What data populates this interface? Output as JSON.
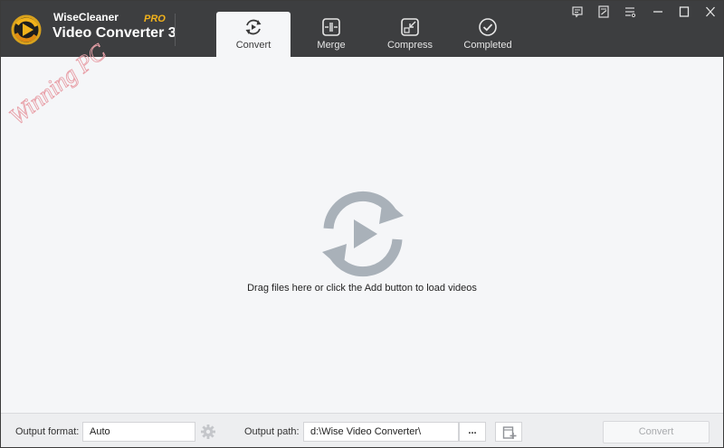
{
  "app": {
    "brand_small": "WiseCleaner",
    "brand_pro": "PRO",
    "brand_big": "Video Converter 3",
    "watermark": "Winning PC"
  },
  "tabs": [
    {
      "label": "Convert",
      "icon": "convert-icon",
      "active": true
    },
    {
      "label": "Merge",
      "icon": "merge-icon",
      "active": false
    },
    {
      "label": "Compress",
      "icon": "compress-icon",
      "active": false
    },
    {
      "label": "Completed",
      "icon": "completed-icon",
      "active": false
    }
  ],
  "window_controls": [
    "feedback-icon",
    "edit-icon",
    "menu-icon",
    "minimize-icon",
    "maximize-icon",
    "close-icon"
  ],
  "main": {
    "drop_text": "Drag files here or click the Add button to load videos"
  },
  "bottom": {
    "output_format_label": "Output format:",
    "output_format_value": "Auto",
    "output_path_label": "Output path:",
    "output_path_value": "d:\\Wise Video Converter\\",
    "browse_label": "...",
    "convert_label": "Convert"
  },
  "colors": {
    "titlebar": "#3d3e40",
    "accent_pro": "#f2b21b",
    "drop_icon": "#a9b1b9"
  }
}
